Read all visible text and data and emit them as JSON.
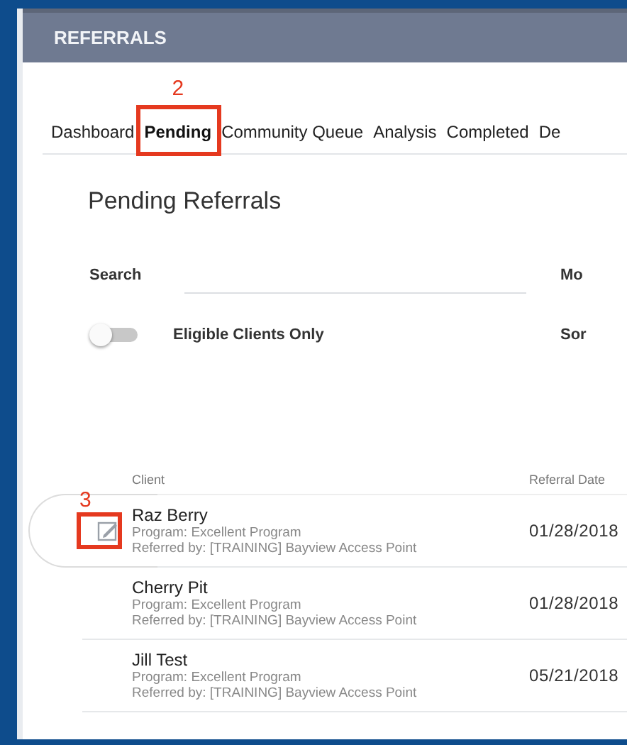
{
  "header": {
    "title": "REFERRALS"
  },
  "tabs": [
    {
      "label": "Dashboard",
      "selected": false
    },
    {
      "label": "Pending",
      "selected": true,
      "callout": "2"
    },
    {
      "label": "Community Queue",
      "selected": false
    },
    {
      "label": "Analysis",
      "selected": false
    },
    {
      "label": "Completed",
      "selected": false
    },
    {
      "label": "De",
      "selected": false
    }
  ],
  "page_title": "Pending Referrals",
  "search": {
    "label": "Search",
    "side_label": "Mo"
  },
  "filter": {
    "label": "Eligible Clients Only",
    "on": false,
    "side_label": "Sor"
  },
  "table": {
    "columns": [
      "Client",
      "Referral Date"
    ],
    "rows": [
      {
        "client": "Raz Berry",
        "program": "Program: Excellent Program",
        "referred_by": "Referred by: [TRAINING] Bayview Access Point",
        "date": "01/28/2018",
        "hovered": true,
        "callout": "3"
      },
      {
        "client": "Cherry Pit",
        "program": "Program: Excellent Program",
        "referred_by": "Referred by: [TRAINING] Bayview Access Point",
        "date": "01/28/2018",
        "hovered": false
      },
      {
        "client": "Jill Test",
        "program": "Program: Excellent Program",
        "referred_by": "Referred by: [TRAINING] Bayview Access Point",
        "date": "05/21/2018",
        "hovered": false
      }
    ]
  }
}
